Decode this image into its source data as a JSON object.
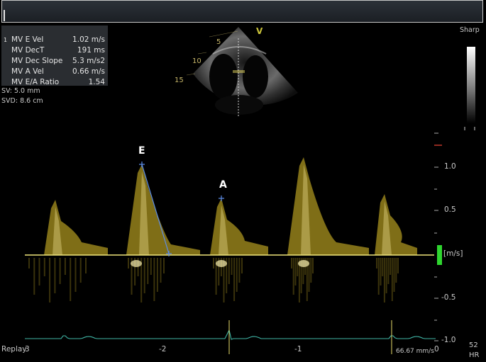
{
  "measurements": [
    {
      "index": "1",
      "label": "MV E Vel",
      "value": "1.02 m/s"
    },
    {
      "label": "MV DecT",
      "value": "191 ms"
    },
    {
      "label": "MV Dec Slope",
      "value": "5.3 m/s2"
    },
    {
      "label": "MV A Vel",
      "value": "0.66 m/s"
    },
    {
      "label": "MV E/A Ratio",
      "value": "1.54"
    }
  ],
  "sample_volume": {
    "sv": "SV: 5.0 mm",
    "svd": "SVD: 8.6 cm"
  },
  "sector_labels": {
    "v": "V",
    "d5": "5",
    "d10": "10",
    "d15": "15"
  },
  "sharp_label": "Sharp",
  "peaks": {
    "e": "E",
    "a": "A"
  },
  "velocity_ticks": [
    "1.0",
    "0.5",
    "-0.5",
    "-1.0"
  ],
  "unit_label": "[m/s]",
  "time_ticks": [
    "3",
    "-2",
    "-1",
    "0"
  ],
  "replay_label": "Replay",
  "hr": {
    "value": "52",
    "label": "HR"
  },
  "interval_label": "66.67 mm/s",
  "colors": {
    "doppler": "#e8c92a",
    "baseline": "#f0e67a",
    "ecg": "#3fb6a6",
    "scale": "#2fd52f",
    "caliper": "#5d8de8"
  }
}
